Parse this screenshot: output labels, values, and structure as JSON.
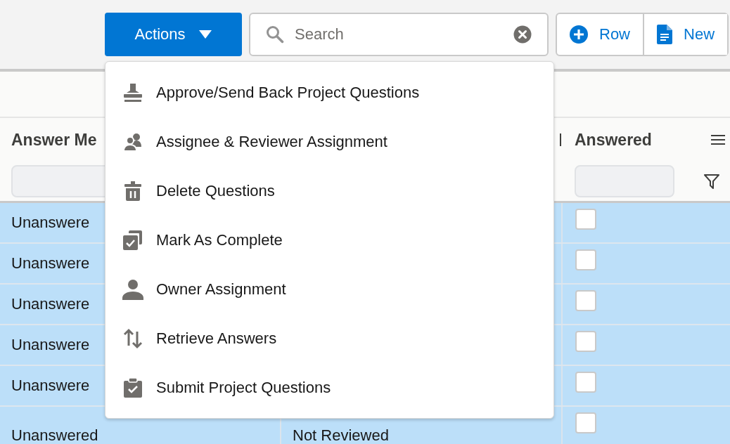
{
  "toolbar": {
    "actions_label": "Actions",
    "search": {
      "placeholder": "Search"
    },
    "buttons": [
      {
        "label": "Row",
        "kind": "add"
      },
      {
        "label": "New",
        "kind": "doc"
      }
    ]
  },
  "menu": {
    "items": [
      {
        "label": "Approve/Send Back Project Questions",
        "kind": "stamp"
      },
      {
        "label": "Assignee & Reviewer Assignment",
        "kind": "assign"
      },
      {
        "label": "Delete Questions",
        "kind": "delete"
      },
      {
        "label": "Mark As Complete",
        "kind": "complete"
      },
      {
        "label": "Owner Assignment",
        "kind": "owner"
      },
      {
        "label": "Retrieve Answers",
        "kind": "retrieve"
      },
      {
        "label": "Submit Project Questions",
        "kind": "submit"
      }
    ]
  },
  "table": {
    "columns": [
      "Answer Me",
      "",
      "Answered"
    ],
    "rows": [
      {
        "column_1": "Unanswere",
        "column_2": "",
        "answered": false,
        "selected": true
      },
      {
        "column_1": "Unanswere",
        "column_2": "",
        "answered": false,
        "selected": true
      },
      {
        "column_1": "Unanswere",
        "column_2": "",
        "answered": false,
        "selected": true
      },
      {
        "column_1": "Unanswere",
        "column_2": "",
        "answered": false,
        "selected": true
      },
      {
        "column_1": "Unanswere",
        "column_2": "",
        "answered": false,
        "selected": true
      },
      {
        "column_1": "Unanswered",
        "column_2": "Not Reviewed",
        "answered": false,
        "selected": true
      }
    ]
  }
}
